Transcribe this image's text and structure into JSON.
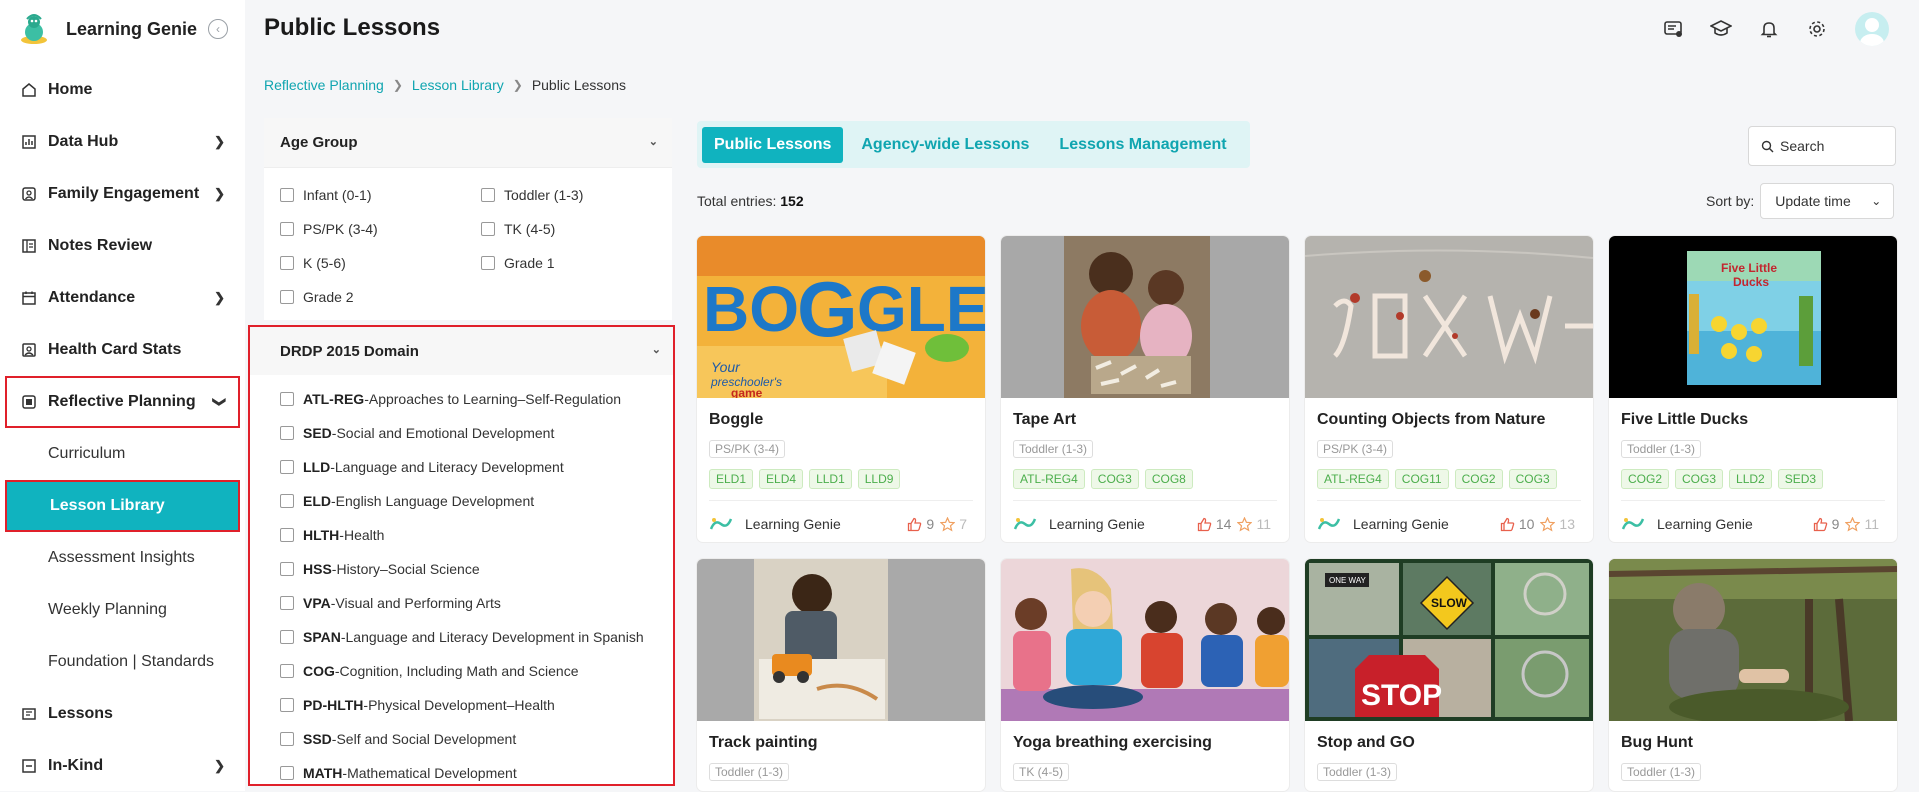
{
  "app": {
    "name": "Learning Genie"
  },
  "header": {
    "title": "Public Lessons"
  },
  "sidebar": {
    "items": [
      {
        "label": "Home",
        "icon": "home-icon",
        "has_children": false
      },
      {
        "label": "Data Hub",
        "icon": "data-hub-icon",
        "has_children": true
      },
      {
        "label": "Family Engagement",
        "icon": "family-engagement-icon",
        "has_children": true
      },
      {
        "label": "Notes Review",
        "icon": "notes-icon",
        "has_children": false
      },
      {
        "label": "Attendance",
        "icon": "calendar-icon",
        "has_children": true
      },
      {
        "label": "Health Card Stats",
        "icon": "health-card-icon",
        "has_children": false
      },
      {
        "label": "Reflective Planning",
        "icon": "reflective-planning-icon",
        "has_children": true,
        "expanded": true
      }
    ],
    "sub_items": [
      {
        "label": "Curriculum"
      },
      {
        "label": "Lesson Library",
        "active": true
      },
      {
        "label": "Assessment Insights"
      },
      {
        "label": "Weekly Planning"
      },
      {
        "label": "Foundation | Standards"
      }
    ],
    "bottom_items": [
      {
        "label": "Lessons",
        "icon": "lessons-icon",
        "has_children": false
      },
      {
        "label": "In-Kind",
        "icon": "in-kind-icon",
        "has_children": true
      }
    ]
  },
  "breadcrumb": {
    "items": [
      "Reflective Planning",
      "Lesson Library"
    ],
    "current": "Public Lessons"
  },
  "filters": {
    "age_group": {
      "title": "Age Group",
      "options": [
        "Infant (0-1)",
        "Toddler (1-3)",
        "PS/PK (3-4)",
        "TK (4-5)",
        "K (5-6)",
        "Grade 1",
        "Grade 2"
      ]
    },
    "domain": {
      "title": "DRDP 2015 Domain",
      "options": [
        {
          "code": "ATL-REG",
          "name": "-Approaches to Learning–Self-Regulation"
        },
        {
          "code": "SED",
          "name": "-Social and Emotional Development"
        },
        {
          "code": "LLD",
          "name": "-Language and Literacy Development"
        },
        {
          "code": "ELD",
          "name": "-English Language Development"
        },
        {
          "code": "HLTH",
          "name": "-Health"
        },
        {
          "code": "HSS",
          "name": "-History–Social Science"
        },
        {
          "code": "VPA",
          "name": "-Visual and Performing Arts"
        },
        {
          "code": "SPAN",
          "name": "-Language and Literacy Development in Spanish"
        },
        {
          "code": "COG",
          "name": "-Cognition, Including Math and Science"
        },
        {
          "code": "PD-HLTH",
          "name": "-Physical Development–Health"
        },
        {
          "code": "SSD",
          "name": "-Self and Social Development"
        },
        {
          "code": "MATH",
          "name": "-Mathematical Development"
        }
      ]
    }
  },
  "tabs": [
    {
      "label": "Public Lessons",
      "active": true
    },
    {
      "label": "Agency-wide Lessons",
      "active": false
    },
    {
      "label": "Lessons Management",
      "active": false
    }
  ],
  "search": {
    "placeholder": "Search"
  },
  "entries": {
    "label": "Total entries:",
    "count": "152"
  },
  "sort": {
    "label": "Sort by:",
    "value": "Update time"
  },
  "cards": [
    {
      "title": "Boggle",
      "age": "PS/PK (3-4)",
      "tags": [
        "ELD1",
        "ELD4",
        "LLD1",
        "LLD9"
      ],
      "publisher": "Learning Genie",
      "likes": "9",
      "favorites": "7",
      "image": "boggle-game-box"
    },
    {
      "title": "Tape Art",
      "age": "Toddler (1-3)",
      "tags": [
        "ATL-REG4",
        "COG3",
        "COG8"
      ],
      "publisher": "Learning Genie",
      "likes": "14",
      "favorites": "11",
      "image": "children-with-tape"
    },
    {
      "title": "Counting Objects from Nature",
      "age": "PS/PK (3-4)",
      "tags": [
        "ATL-REG4",
        "COG11",
        "COG2",
        "COG3"
      ],
      "publisher": "Learning Genie",
      "likes": "10",
      "favorites": "13",
      "image": "chalk-on-pavement"
    },
    {
      "title": "Five Little Ducks",
      "age": "Toddler (1-3)",
      "tags": [
        "COG2",
        "COG3",
        "LLD2",
        "SED3"
      ],
      "publisher": "Learning Genie",
      "likes": "9",
      "favorites": "11",
      "image": "five-little-ducks-book"
    },
    {
      "title": "Track painting",
      "age": "Toddler (1-3)",
      "image": "child-painting-tracks"
    },
    {
      "title": "Yoga breathing exercising",
      "age": "TK (4-5)",
      "image": "children-yoga"
    },
    {
      "title": "Stop and GO",
      "age": "Toddler (1-3)",
      "image": "street-signs-collage"
    },
    {
      "title": "Bug Hunt",
      "age": "Toddler (1-3)",
      "image": "child-searching-ground"
    }
  ],
  "colors": {
    "accent": "#10b3bf",
    "highlight": "#e0202a",
    "tag_green": "#4cae4c",
    "like_red": "#e8604c",
    "star_orange": "#f0a060"
  }
}
